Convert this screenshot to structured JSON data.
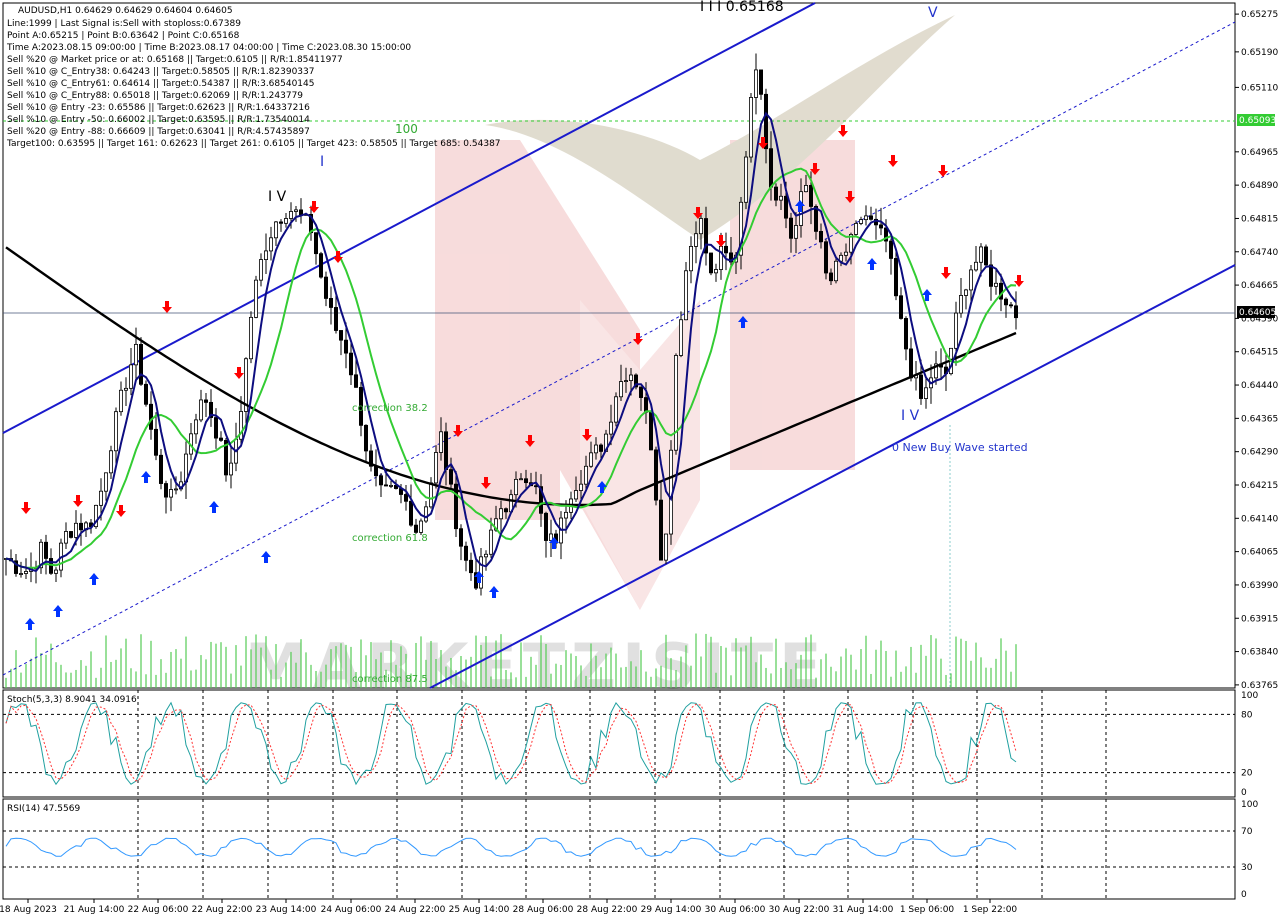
{
  "header": {
    "symbol_line": "AUDUSD,H1  0.64629 0.64629 0.64604 0.64605",
    "lines": [
      "Line:1999 | Last Signal is:Sell with stoploss:0.67389",
      "Point A:0.65215 | Point B:0.63642 | Point C:0.65168",
      "Time A:2023.08.15 09:00:00 | Time B:2023.08.17 04:00:00 | Time C:2023.08.30 15:00:00",
      "Sell %20 @ Market price or at: 0.65168 || Target:0.6105 || R/R:1.85411977",
      "Sell %10 @ C_Entry38: 0.64243 || Target:0.58505 || R/R:1.82390337",
      "Sell %10 @ C_Entry61: 0.64614 || Target:0.54387 || R/R:3.68540145",
      "Sell %10 @ C_Entry88: 0.65018 || Target:0.62069 || R/R:1.243779",
      "Sell %10 @ Entry -23: 0.65586 || Target:0.62623 || R/R:1.64337216",
      "Sell %10 @ Entry -50: 0.66002 || Target:0.63595 || R/R:1.73540014",
      "Sell %20 @ Entry -88: 0.66609 || Target:0.63041 || R/R:4.57435897",
      "Target100: 0.63595 || Target 161: 0.62623 || Target 261: 0.6105 || Target 423: 0.58505 || Target 685: 0.54387"
    ]
  },
  "annotations": {
    "wave_IV_left": "I V",
    "wave_I": "I",
    "wave_III": "I I I 0.65168",
    "wave_V": "V",
    "wave_IV_right": "I V",
    "label_100": "100",
    "correction_382": "correction 38.2",
    "correction_618": "correction 61.8",
    "correction_875": "correction 87.5",
    "new_buy_wave": "0 New Buy Wave started"
  },
  "price_labels": {
    "current": "0.64605",
    "level_green": "0.65093"
  },
  "indicators": {
    "stoch_label": "Stoch(5,3,3) 8.9041 34.0916",
    "rsi_label": "RSI(14) 47.5569"
  },
  "chart_data": [
    {
      "type": "candlestick",
      "title": "AUDUSD,H1",
      "x_tick_labels": [
        "18 Aug 2023",
        "21 Aug 14:00",
        "22 Aug 06:00",
        "22 Aug 22:00",
        "23 Aug 14:00",
        "24 Aug 06:00",
        "24 Aug 22:00",
        "25 Aug 14:00",
        "28 Aug 06:00",
        "28 Aug 22:00",
        "29 Aug 14:00",
        "30 Aug 06:00",
        "30 Aug 22:00",
        "31 Aug 14:00",
        "1 Sep 06:00",
        "1 Sep 22:00"
      ],
      "y_tick_labels": [
        "0.65275",
        "0.65190",
        "0.65110",
        "0.64965",
        "0.64890",
        "0.64815",
        "0.64740",
        "0.64665",
        "0.64590",
        "0.64515",
        "0.64440",
        "0.64365",
        "0.64290",
        "0.64215",
        "0.64140",
        "0.64065",
        "0.63990",
        "0.63915",
        "0.63840",
        "0.63765"
      ],
      "ylim": [
        0.63758,
        0.653
      ],
      "close_path": [
        0.6405,
        0.6403,
        0.6402,
        0.6407,
        0.6401,
        0.641,
        0.6413,
        0.6412,
        0.6419,
        0.6432,
        0.6443,
        0.6452,
        0.6439,
        0.6424,
        0.6418,
        0.6424,
        0.6437,
        0.6441,
        0.6433,
        0.6422,
        0.6439,
        0.6463,
        0.6475,
        0.6481,
        0.6484,
        0.6482,
        0.6479,
        0.6466,
        0.6457,
        0.6452,
        0.644,
        0.6425,
        0.6419,
        0.642,
        0.6418,
        0.6411,
        0.642,
        0.6433,
        0.6418,
        0.6405,
        0.64,
        0.6407,
        0.6416,
        0.6418,
        0.6425,
        0.6422,
        0.6408,
        0.641,
        0.642,
        0.6424,
        0.6428,
        0.6432,
        0.6443,
        0.6448,
        0.6443,
        0.643,
        0.64,
        0.645,
        0.6472,
        0.6483,
        0.6468,
        0.6474,
        0.647,
        0.6497,
        0.652,
        0.649,
        0.6486,
        0.6476,
        0.649,
        0.648,
        0.6466,
        0.6472,
        0.6476,
        0.6483,
        0.6479,
        0.6476,
        0.646,
        0.6448,
        0.644,
        0.6448,
        0.6446,
        0.646,
        0.647,
        0.6473,
        0.6467,
        0.6464,
        0.646
      ],
      "legend": "none"
    },
    {
      "type": "line",
      "title": "Stoch(5,3,3) 8.9041 34.0916",
      "y_tick_labels": [
        "100",
        "80",
        "20",
        "0"
      ],
      "ylim": [
        0,
        100
      ]
    },
    {
      "type": "line",
      "title": "RSI(14) 47.5569",
      "y_tick_labels": [
        "100",
        "70",
        "30",
        "0"
      ],
      "ylim": [
        0,
        100
      ]
    }
  ],
  "colors": {
    "background": "#ffffff",
    "bull_candle": "#000000",
    "bear_candle": "#000000",
    "ma_slow": "#000000",
    "ma_green": "#33cc33",
    "ma_navy": "#0d0d80",
    "channel": "#1a1acc",
    "buy_arrow": "#0033ff",
    "sell_arrow": "#ff0000",
    "stoch_main": "#20a0a0",
    "stoch_signal": "#ff3333",
    "rsi": "#3399ff",
    "watermark": "#e8a0a0"
  }
}
